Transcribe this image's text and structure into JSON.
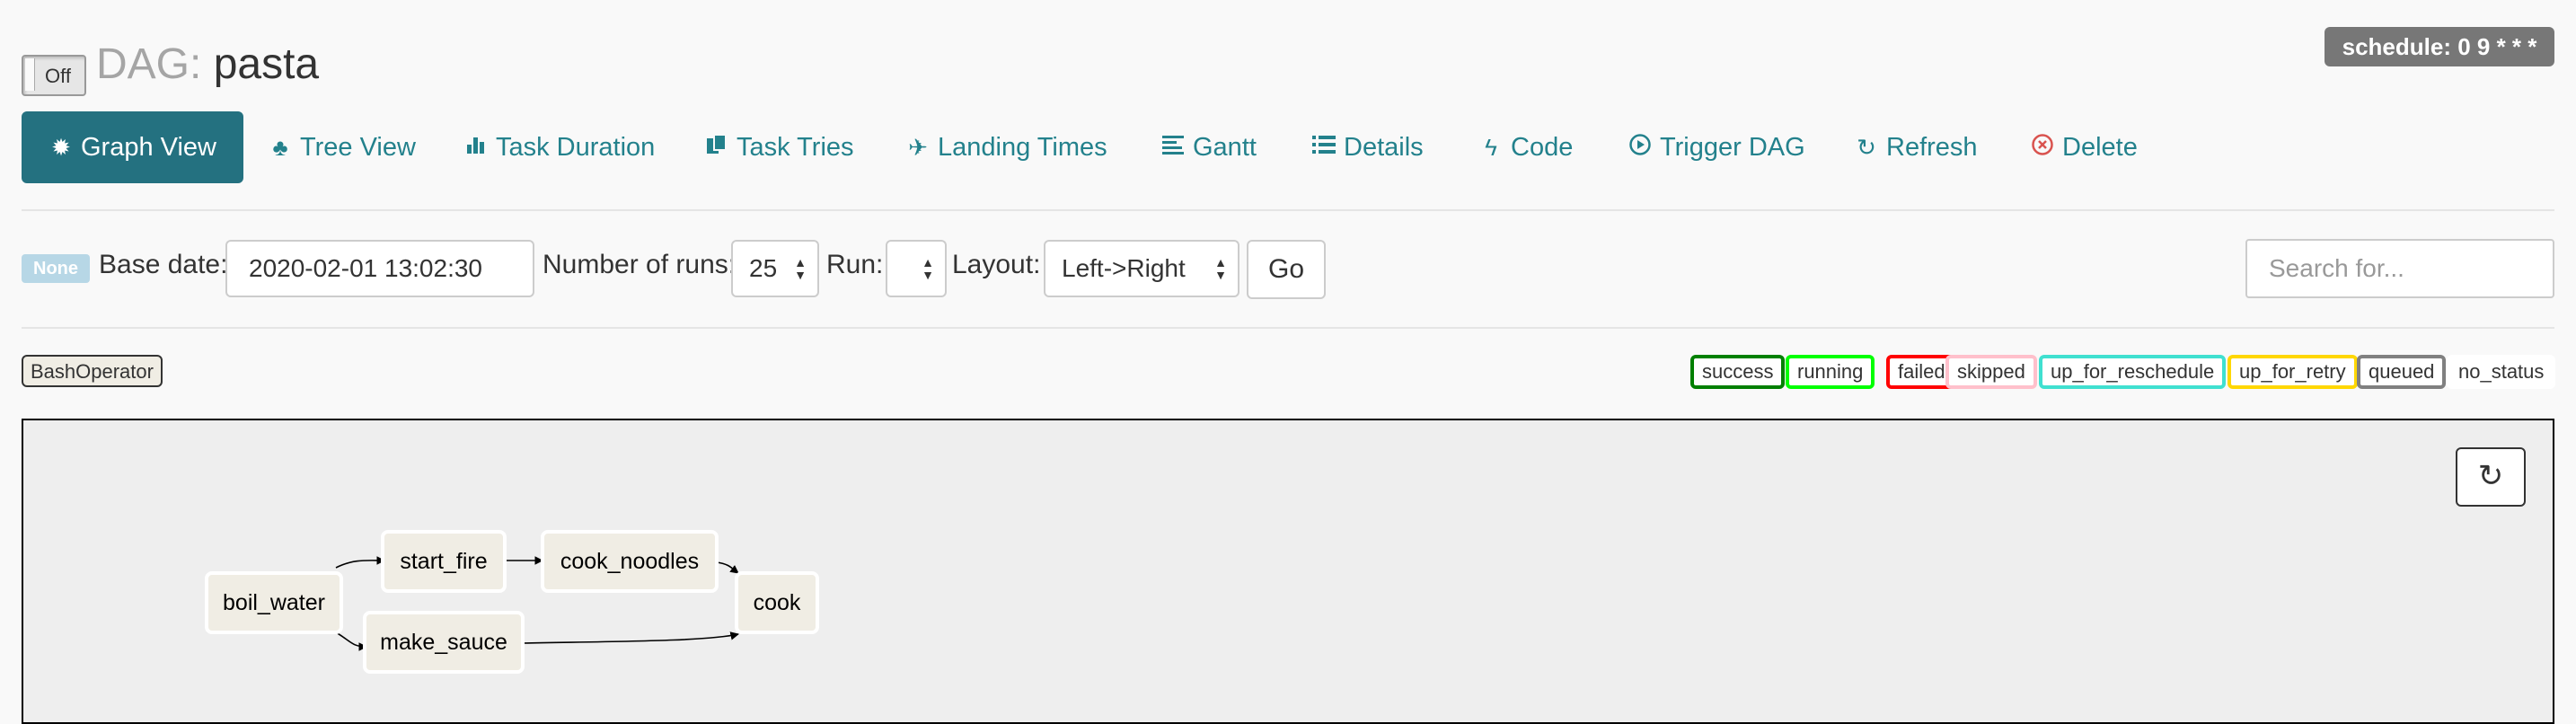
{
  "header": {
    "toggle_label": "Off",
    "title_prefix": "DAG:",
    "dag_name": "pasta",
    "schedule": "schedule: 0 9 * * *"
  },
  "nav": {
    "items": [
      {
        "label": "Graph View",
        "icon": "burst-icon"
      },
      {
        "label": "Tree View",
        "icon": "tree-icon"
      },
      {
        "label": "Task Duration",
        "icon": "bar-chart-icon"
      },
      {
        "label": "Task Tries",
        "icon": "copy-icon"
      },
      {
        "label": "Landing Times",
        "icon": "plane-icon"
      },
      {
        "label": "Gantt",
        "icon": "align-left-icon"
      },
      {
        "label": "Details",
        "icon": "list-icon"
      },
      {
        "label": "Code",
        "icon": "bolt-icon"
      },
      {
        "label": "Trigger DAG",
        "icon": "play-circle-icon"
      },
      {
        "label": "Refresh",
        "icon": "refresh-icon"
      },
      {
        "label": "Delete",
        "icon": "remove-circle-icon"
      }
    ],
    "active": "Graph View"
  },
  "form": {
    "state_label": "None",
    "base_date_label": "Base date:",
    "base_date_value": "2020-02-01 13:02:30",
    "num_runs_label": "Number of runs:",
    "num_runs_value": "25",
    "run_label": "Run:",
    "run_value": "",
    "layout_label": "Layout:",
    "layout_value": "Left->Right",
    "go_label": "Go",
    "search_placeholder": "Search for..."
  },
  "legend": {
    "operators": [
      "BashOperator"
    ],
    "states": [
      {
        "label": "success",
        "color": "#008000"
      },
      {
        "label": "running",
        "color": "#00ff00"
      },
      {
        "label": "failed",
        "color": "#ff0000"
      },
      {
        "label": "skipped",
        "color": "#ffc0cb"
      },
      {
        "label": "up_for_reschedule",
        "color": "#40e0d0"
      },
      {
        "label": "up_for_retry",
        "color": "#ffd700"
      },
      {
        "label": "queued",
        "color": "#808080"
      },
      {
        "label": "no_status",
        "color": "#ffffff"
      }
    ]
  },
  "graph": {
    "nodes": [
      "boil_water",
      "start_fire",
      "cook_noodles",
      "make_sauce",
      "cook"
    ],
    "edges": [
      [
        "boil_water",
        "start_fire"
      ],
      [
        "boil_water",
        "make_sauce"
      ],
      [
        "start_fire",
        "cook_noodles"
      ],
      [
        "cook_noodles",
        "cook"
      ],
      [
        "make_sauce",
        "cook"
      ]
    ]
  }
}
